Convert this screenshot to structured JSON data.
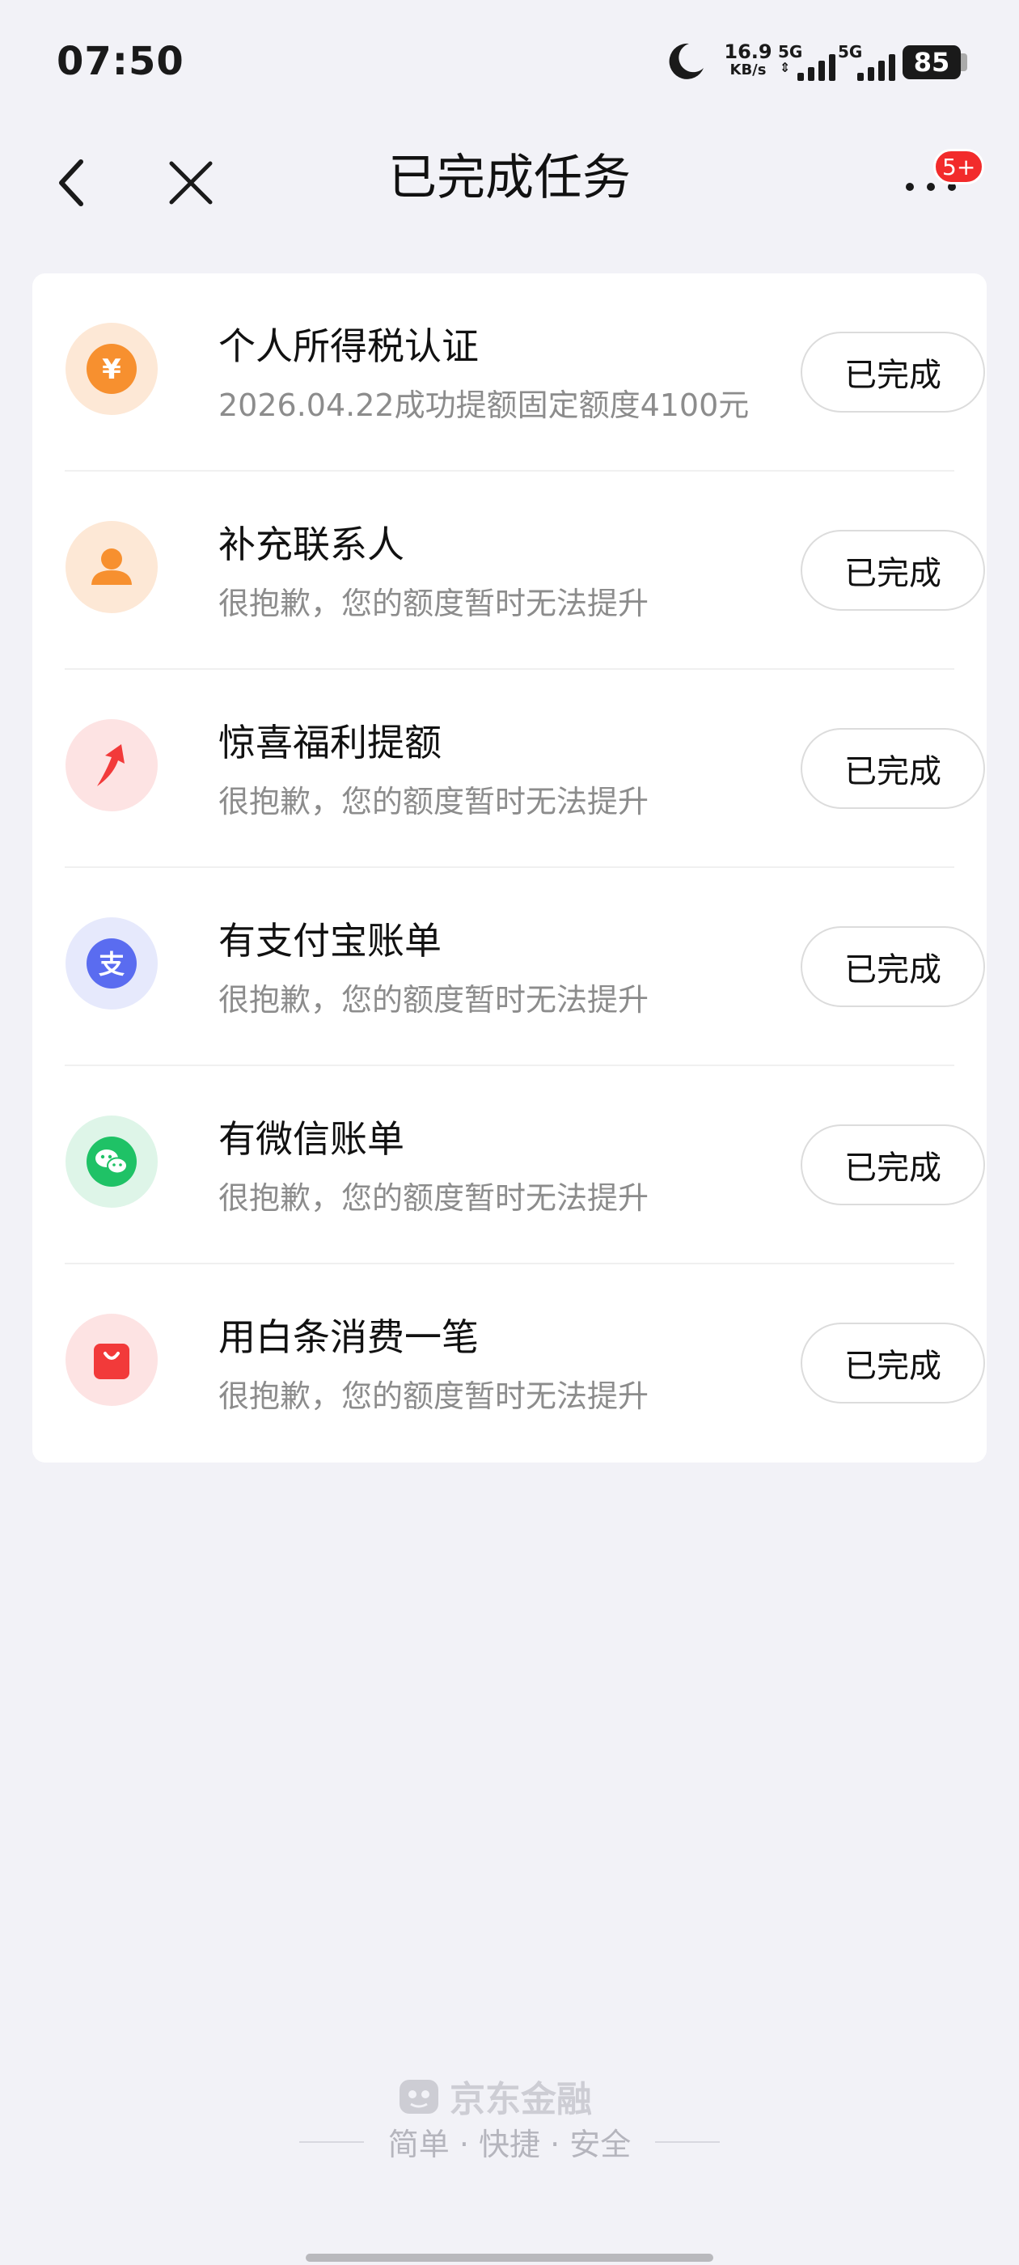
{
  "status_bar": {
    "time": "07:50",
    "net_speed": "16.9",
    "net_speed_unit": "KB/s",
    "signal1_label": "5G",
    "signal2_label": "5G",
    "battery": "85"
  },
  "header": {
    "title": "已完成任务",
    "badge": "5+",
    "back_icon": "chevron-left-icon",
    "close_icon": "close-icon",
    "more_icon": "more-dots-icon"
  },
  "tasks": [
    {
      "title": "个人所得税认证",
      "subtitle": "2026.04.22成功提额固定额度4100元",
      "button": "已完成",
      "icon": "yen-icon",
      "icon_color": "#f7842a"
    },
    {
      "title": "补充联系人",
      "subtitle": "很抱歉，您的额度暂时无法提升",
      "button": "已完成",
      "icon": "person-icon",
      "icon_color": "#f7842a"
    },
    {
      "title": "惊喜福利提额",
      "subtitle": "很抱歉，您的额度暂时无法提升",
      "button": "已完成",
      "icon": "arrow-up-icon",
      "icon_color": "#f23a3a"
    },
    {
      "title": "有支付宝账单",
      "subtitle": "很抱歉，您的额度暂时无法提升",
      "button": "已完成",
      "icon": "alipay-icon",
      "icon_color": "#5a6cf0"
    },
    {
      "title": "有微信账单",
      "subtitle": "很抱歉，您的额度暂时无法提升",
      "button": "已完成",
      "icon": "wechat-icon",
      "icon_color": "#1fc266"
    },
    {
      "title": "用白条消费一笔",
      "subtitle": "很抱歉，您的额度暂时无法提升",
      "button": "已完成",
      "icon": "shopping-bag-icon",
      "icon_color": "#f23a3a"
    }
  ],
  "footer": {
    "brand": "京东金融",
    "slogan": "简单 · 快捷 · 安全"
  }
}
